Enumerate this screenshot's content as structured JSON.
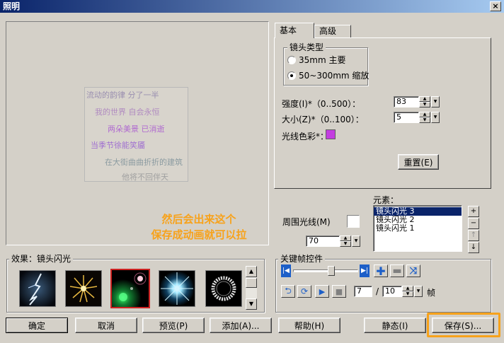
{
  "window": {
    "title": "照明",
    "close_glyph": "×"
  },
  "preview": {
    "poem_lines": [
      "流动的韵律 分了一半",
      "我的世界 自会永恒",
      "两朵美景 已消逝",
      "当季节徐能笑靥",
      "在大街曲曲折折的建筑",
      "他将不回伴天"
    ]
  },
  "annotation": {
    "line1": "然后会出来这个",
    "line2": "保存成动画就可以拉"
  },
  "tabs": [
    {
      "label": "基本"
    },
    {
      "label": "高级"
    }
  ],
  "lens_type": {
    "title": "镜头类型",
    "options": [
      {
        "label": "35mm 主要",
        "selected": false
      },
      {
        "label": "50~300mm 缩放",
        "selected": true
      }
    ]
  },
  "intensity": {
    "label": "强度(I)*（0..500）：",
    "value": "83"
  },
  "size": {
    "label": "大小(Z)*（0..100）：",
    "value": "5"
  },
  "ray_color": {
    "label": "光线色彩*：",
    "color": "#c33ee0"
  },
  "reset_button": "重置(E)",
  "elements": {
    "label": "元素：",
    "items": [
      "镜头闪光 3",
      "镜头闪光 2",
      "镜头闪光 1"
    ],
    "selected_index": 0
  },
  "ambient": {
    "label": "周围光线(M)",
    "value": "70"
  },
  "keyframe": {
    "title": "关键帧控件",
    "frame_current": "7",
    "frame_separator": "/",
    "frame_total": "10",
    "frame_unit": "帧",
    "progress": 0.6
  },
  "effects": {
    "title": "效果：镜头闪光",
    "thumbnails": [
      {
        "name": "lightning",
        "selected": false
      },
      {
        "name": "fireworks",
        "selected": false
      },
      {
        "name": "lens-flare",
        "selected": true
      },
      {
        "name": "starburst",
        "selected": false
      },
      {
        "name": "ring",
        "selected": false
      }
    ]
  },
  "buttons": {
    "ok": "确定",
    "cancel": "取消",
    "preview": "预览(P)",
    "add": "添加(A)...",
    "help": "帮助(H)",
    "static": "静态(I)",
    "save": "保存(S)..."
  },
  "colors": {
    "highlight": "#f7a21b",
    "selection": "#0a246a",
    "thumb_selected_border": "#cc2222"
  }
}
